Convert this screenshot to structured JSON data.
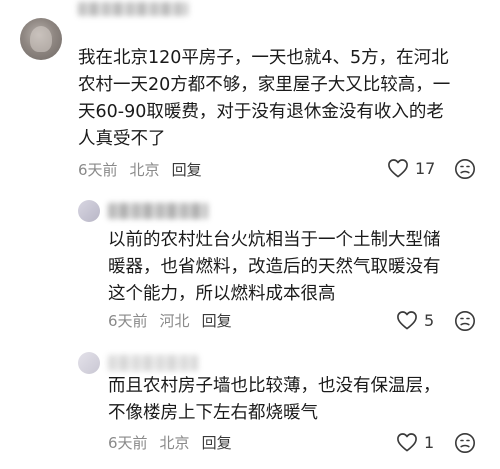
{
  "comment": {
    "avatar_icon": "user-avatar",
    "text": "我在北京120平房子，一天也就4、5方，在河北\n农村一天20方都不够，家里屋子大又比较高，一\n天60-90取暖费，对于没有退休金没有收入的老\n人真受不了",
    "time": "6天前",
    "location": "北京",
    "reply_label": "回复",
    "likes": "17"
  },
  "replies": [
    {
      "text": "以前的农村灶台火炕相当于一个土制大型储\n暖器，也省燃料，改造后的天然气取暖没有\n这个能力，所以燃料成本很高",
      "time": "6天前",
      "location": "河北",
      "reply_label": "回复",
      "likes": "5"
    },
    {
      "text": "而且农村房子墙也比较薄，也没有保温层，\n不像楼房上下左右都烧暖气",
      "time": "6天前",
      "location": "北京",
      "reply_label": "回复",
      "likes": "1"
    }
  ],
  "icons": {
    "like": "heart-outline-icon",
    "dislike": "frown-face-icon"
  },
  "colors": {
    "text": "#1a1a1a",
    "meta": "#8a8a8a",
    "icon": "#3a3a3a"
  }
}
